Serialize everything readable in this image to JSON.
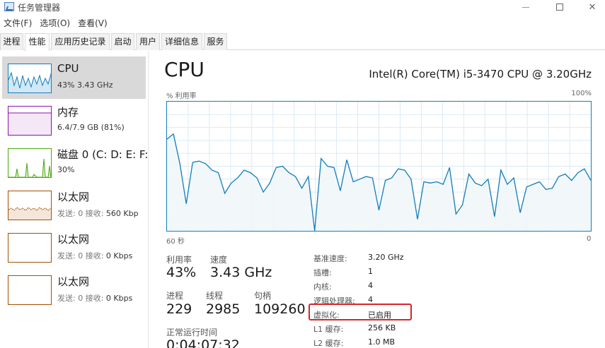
{
  "window": {
    "title": "任务管理器",
    "controls": {
      "minimize": "—",
      "maximize": "",
      "close": "✕"
    }
  },
  "menu": [
    "文件(F)",
    "选项(O)",
    "查看(V)"
  ],
  "tabs": [
    "进程",
    "性能",
    "应用历史记录",
    "启动",
    "用户",
    "详细信息",
    "服务"
  ],
  "active_tab": "性能",
  "sidebar": [
    {
      "title": "CPU",
      "sub_value": "43%  3.43 GHz",
      "color": "#117dbb"
    },
    {
      "title": "内存",
      "sub_value": "6.4/7.9 GB (81%)",
      "color": "#8b12ae"
    },
    {
      "title": "磁盘 0 (C: D: E: F:",
      "sub_value": "30%",
      "color": "#4da60c"
    },
    {
      "title": "以太网",
      "sub_label": "发送: 0  接收: ",
      "sub_value": "560 Kbp",
      "color": "#a74f01"
    },
    {
      "title": "以太网",
      "sub_label": "发送: 0  接收: ",
      "sub_value": "0 Kbps",
      "color": "#a74f01"
    },
    {
      "title": "以太网",
      "sub_label": "发送: 0  接收: ",
      "sub_value": "0 Kbps",
      "color": "#a74f01"
    }
  ],
  "main": {
    "title": "CPU",
    "model": "Intel(R) Core(TM) i5-3470 CPU @ 3.20GHz",
    "y_axis_label": "% 利用率",
    "y_max_label": "100%",
    "x_left_label": "60 秒",
    "x_right_label": "0"
  },
  "chart_data": {
    "type": "area",
    "title": "",
    "ylim": [
      0,
      100
    ],
    "x_range_seconds": [
      60,
      0
    ],
    "x": [
      60,
      59,
      58,
      57,
      56,
      55,
      54,
      53,
      52,
      51,
      50,
      49,
      48,
      47,
      46,
      45,
      44,
      43,
      42,
      41,
      40,
      39,
      38,
      37,
      36,
      35,
      34,
      33,
      32,
      31,
      30,
      29,
      28,
      27,
      26,
      25,
      24,
      23,
      22,
      21,
      20,
      19,
      18,
      17,
      16,
      15,
      14,
      13,
      12,
      11,
      10,
      9,
      8,
      7,
      6,
      5,
      4,
      3,
      2,
      1,
      0
    ],
    "values": [
      71,
      75,
      52,
      21,
      53,
      54,
      52,
      47,
      45,
      29,
      37,
      41,
      47,
      45,
      41,
      30,
      37,
      49,
      50,
      45,
      42,
      33,
      42,
      0,
      56,
      50,
      49,
      31,
      55,
      38,
      40,
      42,
      41,
      16,
      39,
      41,
      48,
      47,
      40,
      9,
      38,
      37,
      38,
      36,
      49,
      13,
      20,
      44,
      37,
      35,
      40,
      11,
      47,
      36,
      41,
      14,
      34,
      36,
      38,
      32,
      33,
      42,
      44,
      39,
      45,
      48,
      39
    ]
  },
  "stats": {
    "utilization_label": "利用率",
    "utilization_value": "43%",
    "speed_label": "速度",
    "speed_value": "3.43 GHz",
    "processes_label": "进程",
    "processes_value": "229",
    "threads_label": "线程",
    "threads_value": "2985",
    "handles_label": "句柄",
    "handles_value": "109260",
    "uptime_label": "正常运行时间",
    "uptime_value": "0:04:07:32"
  },
  "specs": [
    {
      "label": "基准速度:",
      "value": "3.20 GHz"
    },
    {
      "label": "插槽:",
      "value": "1"
    },
    {
      "label": "内核:",
      "value": "4"
    },
    {
      "label": "逻辑处理器:",
      "value": "4"
    },
    {
      "label": "虚拟化:",
      "value": "已启用"
    },
    {
      "label": "L1 缓存:",
      "value": "256 KB"
    },
    {
      "label": "L2 缓存:",
      "value": "1.0 MB"
    }
  ],
  "highlight_color": "#d6242b"
}
